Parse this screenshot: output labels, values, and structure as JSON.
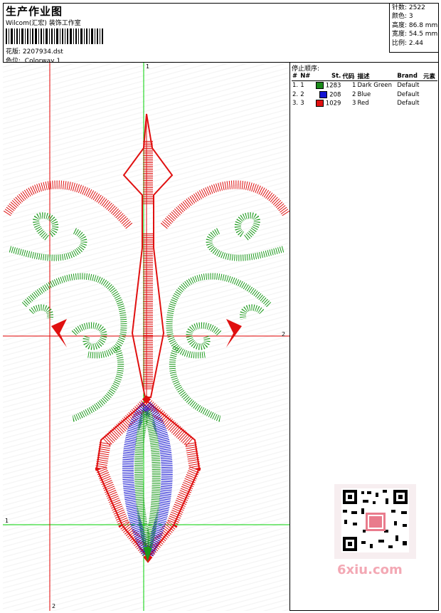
{
  "header": {
    "title": "生产作业图",
    "company": "Wilcom(汇宏) 装饰工作室",
    "design_label": "花版:",
    "design_file": "2207934.dst",
    "colorway_label": "色位:",
    "colorway_value": "Colorway 1"
  },
  "stats": {
    "stitches": "针数: 2522",
    "colors": "颜色: 3",
    "height": "高度: 86.8 mm",
    "width": "宽度: 54.5 mm",
    "ratio": "比例: 2.44"
  },
  "stop_sequence": {
    "title": "停止顺序:",
    "columns": [
      "#",
      "N#",
      "St.",
      "代码",
      "描述",
      "Brand",
      "元素"
    ],
    "rows": [
      {
        "idx": "1.",
        "n": "1",
        "color": "#1a8a1a",
        "st": "1283",
        "code": "1",
        "desc": "Dark Green",
        "brand": "Default"
      },
      {
        "idx": "2.",
        "n": "2",
        "color": "#1414d2",
        "st": "208",
        "code": "2",
        "desc": "Blue",
        "brand": "Default"
      },
      {
        "idx": "3.",
        "n": "3",
        "color": "#e01010",
        "st": "1029",
        "code": "3",
        "desc": "Red",
        "brand": "Default"
      }
    ]
  },
  "canvas": {
    "marker_top": "1",
    "marker_right": "2",
    "marker_left": "1",
    "marker_bottom": "2"
  },
  "watermark": {
    "logo_text": "6xiu.com"
  },
  "colors": {
    "green": "#1a9a1a",
    "blue": "#1414d2",
    "red": "#e01010",
    "guide_green": "#00d000",
    "guide_red": "#e00000"
  }
}
